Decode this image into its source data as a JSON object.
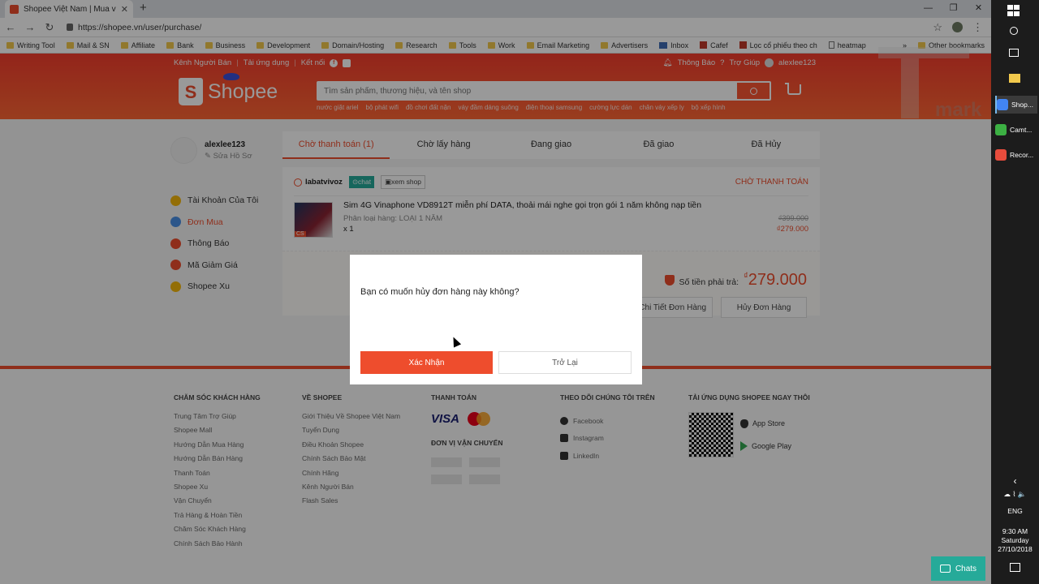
{
  "browser": {
    "tab_title": "Shopee Việt Nam | Mua và Bán T",
    "tab_close": "✕",
    "new_tab": "+",
    "url": "https://shopee.vn/user/purchase/",
    "nav": {
      "back": "←",
      "forward": "→",
      "reload": "↻"
    },
    "window": {
      "minimize": "—",
      "maximize": "❐",
      "close": "✕"
    },
    "star": "☆",
    "menu": "⋮",
    "bookmarks": [
      {
        "label": "Writing Tool",
        "icon": "folder-icon"
      },
      {
        "label": "Mail & SN",
        "icon": "folder-icon"
      },
      {
        "label": "Affiliate",
        "icon": "folder-icon"
      },
      {
        "label": "Bank",
        "icon": "folder-icon"
      },
      {
        "label": "Business",
        "icon": "folder-icon"
      },
      {
        "label": "Development",
        "icon": "folder-icon"
      },
      {
        "label": "Domain/Hosting",
        "icon": "folder-icon"
      },
      {
        "label": "Research",
        "icon": "folder-icon"
      },
      {
        "label": "Tools",
        "icon": "folder-icon"
      },
      {
        "label": "Work",
        "icon": "folder-icon"
      },
      {
        "label": "Email Marketing",
        "icon": "folder-icon"
      },
      {
        "label": "Advertisers",
        "icon": "folder-icon"
      },
      {
        "label": "Inbox",
        "icon": "mail-icon"
      },
      {
        "label": "Cafef",
        "icon": "site-icon"
      },
      {
        "label": "Lọc cổ phiếu theo ch",
        "icon": "site-icon"
      },
      {
        "label": "heatmap",
        "icon": "page-icon"
      }
    ],
    "bookmarks_more": "»",
    "other_bookmarks": "Other bookmarks"
  },
  "header": {
    "seller_center": "Kênh Người Bán",
    "download_app": "Tải ứng dụng",
    "connect": "Kết nối",
    "notifications": "Thông Báo",
    "help": "Trợ Giúp",
    "username": "alexlee123",
    "logo_text": "Shopee",
    "logo_letter": "S",
    "search_placeholder": "Tìm sản phẩm, thương hiệu, và tên shop",
    "suggestions": [
      "nước giặt ariel",
      "bộ phát wifi",
      "đồ chơi đất nặn",
      "váy đầm dáng suông",
      "điện thoại samsung",
      "cường lực dán",
      "chân váy xếp ly",
      "bộ xếp hình"
    ]
  },
  "watermark": {
    "text": "mark"
  },
  "sidebar": {
    "username": "alexlee123",
    "edit_profile": "✎ Sửa Hồ Sơ",
    "items": [
      {
        "label": "Tài Khoản Của Tôi",
        "color": "#f5b70c"
      },
      {
        "label": "Đơn Mua",
        "color": "#4a8fe7"
      },
      {
        "label": "Thông Báo",
        "color": "#ee4d2d"
      },
      {
        "label": "Mã Giảm Giá",
        "color": "#ee4d2d"
      },
      {
        "label": "Shopee Xu",
        "color": "#f5b70c"
      }
    ]
  },
  "order_tabs": [
    "Chờ thanh toán (1)",
    "Chờ lấy hàng",
    "Đang giao",
    "Đã giao",
    "Đã Hủy"
  ],
  "order": {
    "shop_name": "labatvivoz",
    "chat": "⊙chat",
    "view_shop": "▣xem shop",
    "status": "CHỜ THANH TOÁN",
    "product_title": "Sim 4G Vinaphone VD8912T miễn phí DATA, thoải mái nghe gọi trọn gói 1 năm không nạp tiền",
    "variation": "Phân loại hàng: LOẠI 1 NĂM",
    "quantity": "x 1",
    "thumb_badge": "CS",
    "original_price": "₫399.000",
    "price": "₫279.000",
    "total_label": "Số tiền phải trả:",
    "total_currency": "₫",
    "total_amount": "279.000",
    "detail_button": "Xem Chi Tiết Đơn Hàng",
    "cancel_button": "Hủy Đơn Hàng"
  },
  "dialog": {
    "message": "Bạn có muốn hủy đơn hàng này không?",
    "confirm": "Xác Nhận",
    "back": "Trở Lại"
  },
  "footer": {
    "customer_care": {
      "title": "CHĂM SÓC KHÁCH HÀNG",
      "links": [
        "Trung Tâm Trợ Giúp",
        "Shopee Mall",
        "Hướng Dẫn Mua Hàng",
        "Hướng Dẫn Bán Hàng",
        "Thanh Toán",
        "Shopee Xu",
        "Vận Chuyển",
        "Trả Hàng & Hoàn Tiền",
        "Chăm Sóc Khách Hàng",
        "Chính Sách Bảo Hành"
      ]
    },
    "about": {
      "title": "VỀ SHOPEE",
      "links": [
        "Giới Thiệu Về Shopee Việt Nam",
        "Tuyển Dụng",
        "Điều Khoản Shopee",
        "Chính Sách Bảo Mật",
        "Chính Hãng",
        "Kênh Người Bán",
        "Flash Sales"
      ]
    },
    "payment_title": "THANH TOÁN",
    "visa": "VISA",
    "shipping_title": "ĐƠN VỊ VẬN CHUYỂN",
    "follow_title": "THEO DÕI CHÚNG TÔI TRÊN",
    "social": [
      "Facebook",
      "Instagram",
      "LinkedIn"
    ],
    "app_title": "TẢI ỨNG DỤNG SHOPEE NGAY THÔI",
    "app_store": "App Store",
    "google_play": "Google Play"
  },
  "chats_button": "Chats",
  "taskbar": {
    "apps": [
      {
        "label": "Shop...",
        "color": "#4285f4"
      },
      {
        "label": "Camt...",
        "color": "#3cb043"
      },
      {
        "label": "Recor...",
        "color": "#e74c3c"
      }
    ],
    "chevron": "‹",
    "tray_icons": "☁ ⌇ 🔈",
    "language": "ENG",
    "time": "9:30 AM",
    "day": "Saturday",
    "date": "27/10/2018"
  }
}
